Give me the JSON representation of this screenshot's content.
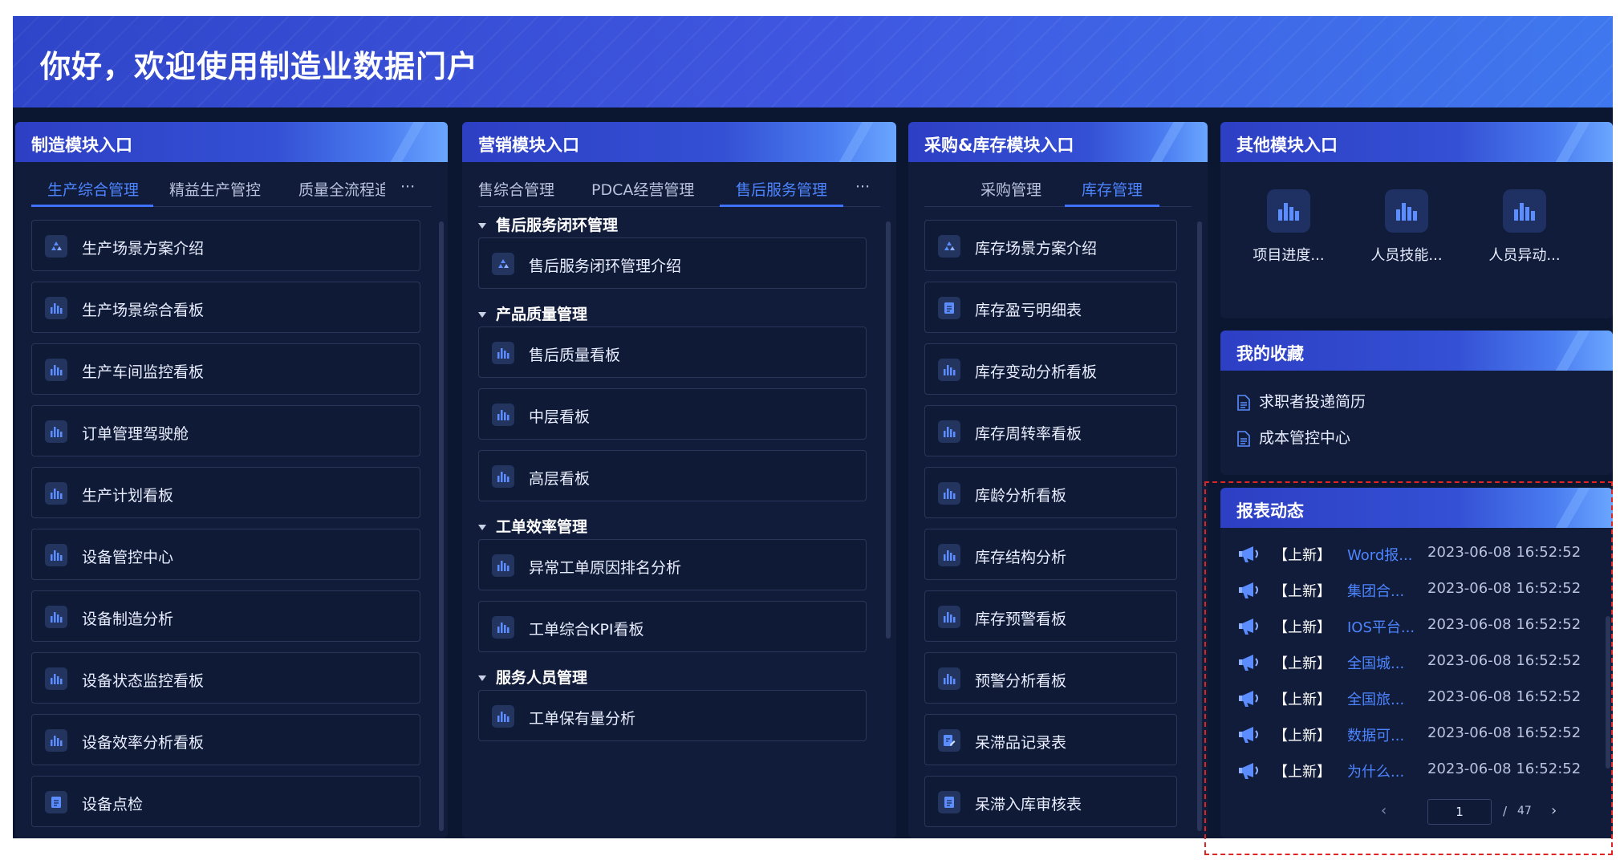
{
  "banner": {
    "title": "你好，欢迎使用制造业数据门户"
  },
  "manufacturing": {
    "title": "制造模块入口",
    "tabs": [
      "生产综合管理",
      "精益生产管控",
      "质量全流程追",
      "···"
    ],
    "items": [
      {
        "label": "生产场景方案介绍",
        "icon": "recycle-icon"
      },
      {
        "label": "生产场景综合看板",
        "icon": "bar-chart-icon"
      },
      {
        "label": "生产车间监控看板",
        "icon": "bar-chart-icon"
      },
      {
        "label": "订单管理驾驶舱",
        "icon": "bar-chart-icon"
      },
      {
        "label": "生产计划看板",
        "icon": "bar-chart-icon"
      },
      {
        "label": "设备管控中心",
        "icon": "bar-chart-icon"
      },
      {
        "label": "设备制造分析",
        "icon": "bar-chart-icon"
      },
      {
        "label": "设备状态监控看板",
        "icon": "bar-chart-icon"
      },
      {
        "label": "设备效率分析看板",
        "icon": "bar-chart-icon"
      },
      {
        "label": "设备点检",
        "icon": "form-icon"
      }
    ]
  },
  "marketing": {
    "title": "营销模块入口",
    "tabs": [
      "售综合管理",
      "PDCA经营管理",
      "售后服务管理",
      "···"
    ],
    "groups": [
      {
        "title": "售后服务闭环管理",
        "items": [
          {
            "label": "售后服务闭环管理介绍",
            "icon": "recycle-icon"
          }
        ]
      },
      {
        "title": "产品质量管理",
        "items": [
          {
            "label": "售后质量看板",
            "icon": "bar-chart-icon"
          },
          {
            "label": "中层看板",
            "icon": "bar-chart-icon"
          },
          {
            "label": "高层看板",
            "icon": "bar-chart-icon"
          }
        ]
      },
      {
        "title": "工单效率管理",
        "items": [
          {
            "label": "异常工单原因排名分析",
            "icon": "bar-chart-icon"
          },
          {
            "label": "工单综合KPI看板",
            "icon": "bar-chart-icon"
          }
        ]
      },
      {
        "title": "服务人员管理",
        "items": [
          {
            "label": "工单保有量分析",
            "icon": "bar-chart-icon"
          }
        ]
      }
    ]
  },
  "purchase": {
    "title": "采购&库存模块入口",
    "tabs": [
      "采购管理",
      "库存管理"
    ],
    "items": [
      {
        "label": "库存场景方案介绍",
        "icon": "recycle-icon"
      },
      {
        "label": "库存盈亏明细表",
        "icon": "form-icon"
      },
      {
        "label": "库存变动分析看板",
        "icon": "bar-chart-icon"
      },
      {
        "label": "库存周转率看板",
        "icon": "bar-chart-icon"
      },
      {
        "label": "库龄分析看板",
        "icon": "bar-chart-icon"
      },
      {
        "label": "库存结构分析",
        "icon": "bar-chart-icon"
      },
      {
        "label": "库存预警看板",
        "icon": "bar-chart-icon"
      },
      {
        "label": "预警分析看板",
        "icon": "bar-chart-icon"
      },
      {
        "label": "呆滞品记录表",
        "icon": "edit-form-icon"
      },
      {
        "label": "呆滞入库审核表",
        "icon": "form-icon"
      }
    ]
  },
  "other": {
    "title": "其他模块入口",
    "tiles": [
      "项目进度...",
      "人员技能...",
      "人员异动..."
    ]
  },
  "favorites": {
    "title": "我的收藏",
    "items": [
      "求职者投递简历",
      "成本管控中心"
    ]
  },
  "reports": {
    "title": "报表动态",
    "items": [
      {
        "tag": "【上新】",
        "name": "Word报...",
        "time": "2023-06-08 16:52:52"
      },
      {
        "tag": "【上新】",
        "name": "集团合...",
        "time": "2023-06-08 16:52:52"
      },
      {
        "tag": "【上新】",
        "name": "IOS平台...",
        "time": "2023-06-08 16:52:52"
      },
      {
        "tag": "【上新】",
        "name": "全国城...",
        "time": "2023-06-08 16:52:52"
      },
      {
        "tag": "【上新】",
        "name": "全国旅...",
        "time": "2023-06-08 16:52:52"
      },
      {
        "tag": "【上新】",
        "name": "数据可...",
        "time": "2023-06-08 16:52:52"
      },
      {
        "tag": "【上新】",
        "name": "为什么...",
        "time": "2023-06-08 16:52:52"
      }
    ],
    "pager": {
      "current": "1",
      "separator": "/",
      "total": "47"
    }
  },
  "colors": {
    "accent": "#4d84ff",
    "panel": "#111c3a",
    "background": "#0b1630"
  }
}
